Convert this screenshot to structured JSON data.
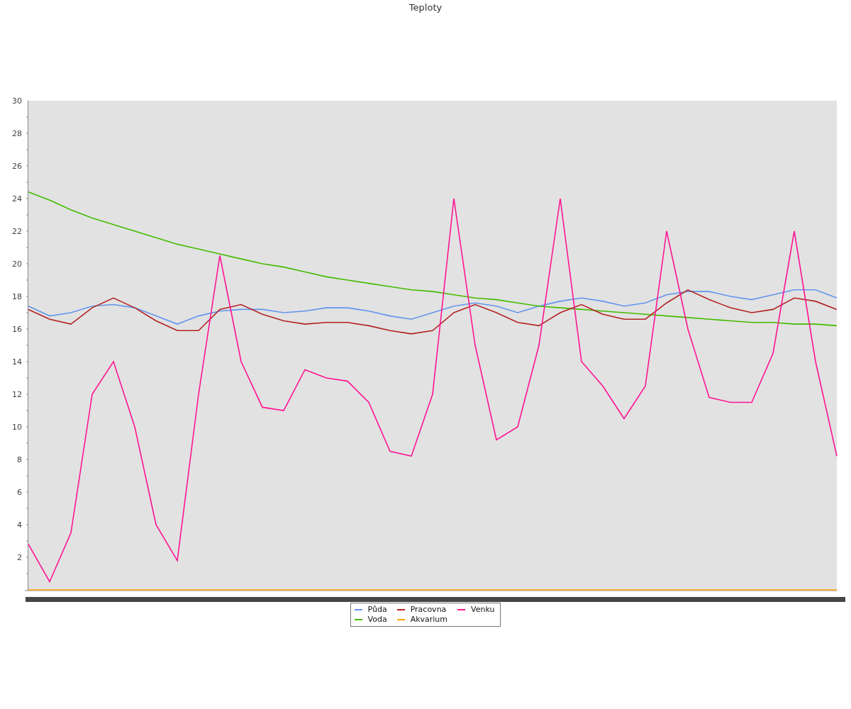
{
  "title": "Teploty",
  "chart_data": {
    "type": "line",
    "ylim": [
      0,
      30
    ],
    "yticks": [
      2,
      4,
      6,
      8,
      10,
      12,
      14,
      16,
      18,
      20,
      22,
      24,
      26,
      28,
      30
    ],
    "series": [
      {
        "name": "Půda",
        "color": "#6495ed",
        "values": [
          17.4,
          16.8,
          17.0,
          17.4,
          17.5,
          17.3,
          16.8,
          16.3,
          16.8,
          17.1,
          17.2,
          17.2,
          17.0,
          17.1,
          17.3,
          17.3,
          17.1,
          16.8,
          16.6,
          17.0,
          17.4,
          17.6,
          17.4,
          17.0,
          17.4,
          17.7,
          17.9,
          17.7,
          17.4,
          17.6,
          18.1,
          18.3,
          18.3,
          18.0,
          17.8,
          18.1,
          18.4,
          18.4,
          17.9
        ]
      },
      {
        "name": "Voda",
        "color": "#44bb00",
        "values": [
          24.4,
          23.9,
          23.3,
          22.8,
          22.4,
          22.0,
          21.6,
          21.2,
          20.9,
          20.6,
          20.3,
          20.0,
          19.8,
          19.5,
          19.2,
          19.0,
          18.8,
          18.6,
          18.4,
          18.3,
          18.1,
          17.9,
          17.8,
          17.6,
          17.4,
          17.3,
          17.2,
          17.1,
          17.0,
          16.9,
          16.8,
          16.7,
          16.6,
          16.5,
          16.4,
          16.4,
          16.3,
          16.3,
          16.2
        ]
      },
      {
        "name": "Pracovna",
        "color": "#b22222",
        "values": [
          17.2,
          16.6,
          16.3,
          17.3,
          17.9,
          17.3,
          16.5,
          15.9,
          15.9,
          17.2,
          17.5,
          16.9,
          16.5,
          16.3,
          16.4,
          16.4,
          16.2,
          15.9,
          15.7,
          15.9,
          17.0,
          17.5,
          17.0,
          16.4,
          16.2,
          17.0,
          17.5,
          16.9,
          16.6,
          16.6,
          17.6,
          18.4,
          17.8,
          17.3,
          17.0,
          17.2,
          17.9,
          17.7,
          17.2
        ]
      },
      {
        "name": "Akvarium",
        "color": "#ffa500",
        "values": [
          0,
          0,
          0,
          0,
          0,
          0,
          0,
          0,
          0,
          0,
          0,
          0,
          0,
          0,
          0,
          0,
          0,
          0,
          0,
          0,
          0,
          0,
          0,
          0,
          0,
          0,
          0,
          0,
          0,
          0,
          0,
          0,
          0,
          0,
          0,
          0,
          0,
          0,
          0
        ]
      },
      {
        "name": "Venku",
        "color": "#ff1493",
        "values": [
          2.8,
          0.5,
          3.5,
          12.0,
          14.0,
          10.0,
          4.0,
          1.8,
          12.0,
          20.5,
          14.0,
          11.2,
          11.0,
          13.5,
          13.0,
          12.8,
          11.5,
          8.5,
          8.2,
          12.0,
          24.0,
          15.0,
          9.2,
          10.0,
          15.0,
          24.0,
          14.0,
          12.5,
          10.5,
          12.5,
          22.0,
          16.0,
          11.8,
          11.5,
          11.5,
          14.5,
          22.0,
          14.0,
          8.2
        ]
      }
    ]
  }
}
